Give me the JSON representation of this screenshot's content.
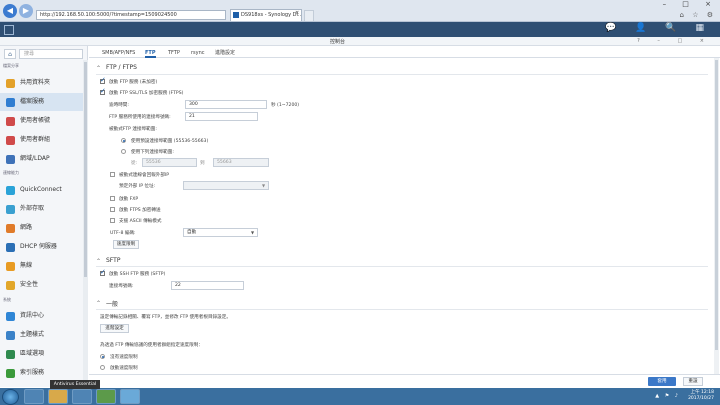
{
  "browser": {
    "address": "http://192.168.50.100:5000/?timestamp=1509024500",
    "tab_title": "DS918xs - Synology Di...",
    "tab_close": "×",
    "window_controls": "– □ ×",
    "toolbar_icons": "⌂ ☆ ⚙"
  },
  "dsm": {
    "bar_icons": "💬 👤 🔍 ▦",
    "cp_title": "控制台",
    "cp_window_buttons": "? – □ ×"
  },
  "sidebar": {
    "search_placeholder": "搜尋",
    "sections": {
      "file_sharing": "檔案分享",
      "connectivity": "連線能力",
      "system": "系統"
    },
    "items": [
      {
        "label": "共用資料夾",
        "color": "#e3a12a"
      },
      {
        "label": "檔案服務",
        "color": "#2f7dd1"
      },
      {
        "label": "使用者帳號",
        "color": "#d04a4a"
      },
      {
        "label": "使用者群組",
        "color": "#d04a4a"
      },
      {
        "label": "網域/LDAP",
        "color": "#3f72b8"
      },
      {
        "label": "QuickConnect",
        "color": "#2aa3d8"
      },
      {
        "label": "外部存取",
        "color": "#3aa0d0"
      },
      {
        "label": "網路",
        "color": "#e07b2a"
      },
      {
        "label": "DHCP 伺服器",
        "color": "#2b6fb5"
      },
      {
        "label": "無線",
        "color": "#e89b23"
      },
      {
        "label": "安全性",
        "color": "#e2a72a"
      },
      {
        "label": "資訊中心",
        "color": "#2f86d6"
      },
      {
        "label": "主題樣式",
        "color": "#3b82c8"
      },
      {
        "label": "區域選項",
        "color": "#2f8a4f"
      },
      {
        "label": "索引服務",
        "color": "#3b9a3b"
      }
    ]
  },
  "tabs": [
    "SMB/AFP/NFS",
    "FTP",
    "TFTP",
    "rsync",
    "進階設定"
  ],
  "ftp": {
    "section_title": "FTP / FTPS",
    "enable_ftp": "啟動 FTP 服務 (未加密)",
    "enable_ftps": "啟動 FTP SSL/TLS 加密服務 (FTPS)",
    "timeout_label": "逾時時間:",
    "timeout_value": "300",
    "timeout_unit": "秒 (1~7200)",
    "port_label": "FTP 服務所使用的連接埠號碼:",
    "port_value": "21",
    "passive_label": "被動式FTP 連接埠範圍:",
    "default_range": "使用預設連接埠範圍 (55536-55663)",
    "custom_range": "使用下列連接埠範圍:",
    "from_label": "從:",
    "from_value": "55536",
    "to_label": "到",
    "to_value": "55663",
    "external_ip": "被動式連線會回報外部IP",
    "external_ip_label": "預定外部 IP 位址:",
    "fxp": "啟動 FXP",
    "ftps_forward": "啟動 FTPS 加密轉送",
    "ascii": "支援 ASCII 傳輸模式",
    "utf8_label": "UTF-8 編碼:",
    "utf8_value": "自動",
    "speed_button": "速度限制"
  },
  "sftp": {
    "section_title": "SFTP",
    "enable_sftp": "啟動 SSH FTP 服務 (SFTP)",
    "port_label": "連接埠號碼:",
    "port_value": "22"
  },
  "general": {
    "section_title": "一般",
    "desc": "設定傳輸記錄相關、覆寫 FTP，並修改 FTP 使用者根目錄設定。",
    "advanced_button": "進階設定",
    "speed_desc": "為透過 FTP 傳輸協議的使用者群組指定速度限制：",
    "no_limit": "沒有速度限制",
    "enable_limit": "啟動速度限制"
  },
  "footer": {
    "apply": "套用",
    "reset": "重設"
  },
  "taskbar": {
    "tooltip": "Antivirus Essential",
    "time": "上午 12:18",
    "date": "2017/10/27",
    "tray_icons": "▲ ⚑ ♪"
  }
}
